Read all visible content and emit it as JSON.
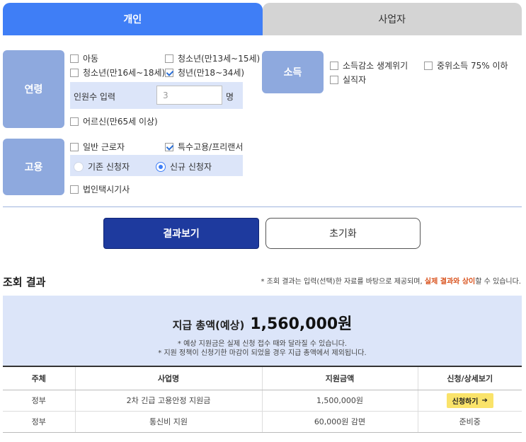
{
  "tabs": [
    {
      "label": "개인"
    },
    {
      "label": "사업자"
    }
  ],
  "categories": {
    "age": "연령",
    "employment": "고용",
    "income": "소득"
  },
  "age_options": {
    "child": "아동",
    "youth_13_15": "청소년(만13세~15세)",
    "youth_16_18": "청소년(만16세~18세)",
    "young_18_34": "청년(만18~34세)",
    "senior": "어르신(만65세 이상)"
  },
  "headcount": {
    "label": "인원수 입력",
    "value": "3",
    "unit": "명"
  },
  "employment_options": {
    "general": "일반 근로자",
    "special": "특수고용/프리랜서",
    "taxi": "법인택시기사"
  },
  "applicant": {
    "existing": "기존 신청자",
    "new": "신규 신청자"
  },
  "income_options": {
    "decrease": "소득감소 생계위기",
    "median": "중위소득 75% 이하",
    "unemployed": "실직자"
  },
  "buttons": {
    "view_results": "결과보기",
    "reset": "초기화"
  },
  "results": {
    "title": "조회 결과",
    "notice_pre": "* 조회 결과는 입력(선택)한 자료를 바탕으로 제공되며, ",
    "notice_hl": "실제 결과와 상이",
    "notice_post": "할 수 있습니다."
  },
  "summary": {
    "label": "지급 총액(예상)",
    "amount": "1,560,000원",
    "note1": "* 예상 지원금은 실제 신청 접수 때와 달라질 수 있습니다.",
    "note2": "* 지원 정책이 신청기한 마감이 되었을 경우 지급 총액에서 제외됩니다."
  },
  "table": {
    "headers": [
      "주체",
      "사업명",
      "지원금액",
      "신청/상세보기"
    ],
    "rows": [
      {
        "subject": "정부",
        "program": "2차 긴급 고용안정 지원금",
        "amount": "1,500,000원",
        "action": "신청하기"
      },
      {
        "subject": "정부",
        "program": "통신비 지원",
        "amount": "60,000원 감면",
        "action": "준비중"
      }
    ]
  },
  "colors": {
    "accent": "#3f7ef6",
    "category": "#8ea9de",
    "band": "#dce5f9",
    "primary_button": "#1e3a9e",
    "highlight": "#d9531e",
    "apply_button": "#fae36a"
  },
  "icons": [
    "check-icon",
    "radio-icon",
    "arrow-right-icon"
  ],
  "state": {
    "active_tab": "개인",
    "checked": [
      "청년(만18~34세)",
      "특수고용/프리랜서"
    ],
    "selected_applicant": "신규 신청자"
  }
}
